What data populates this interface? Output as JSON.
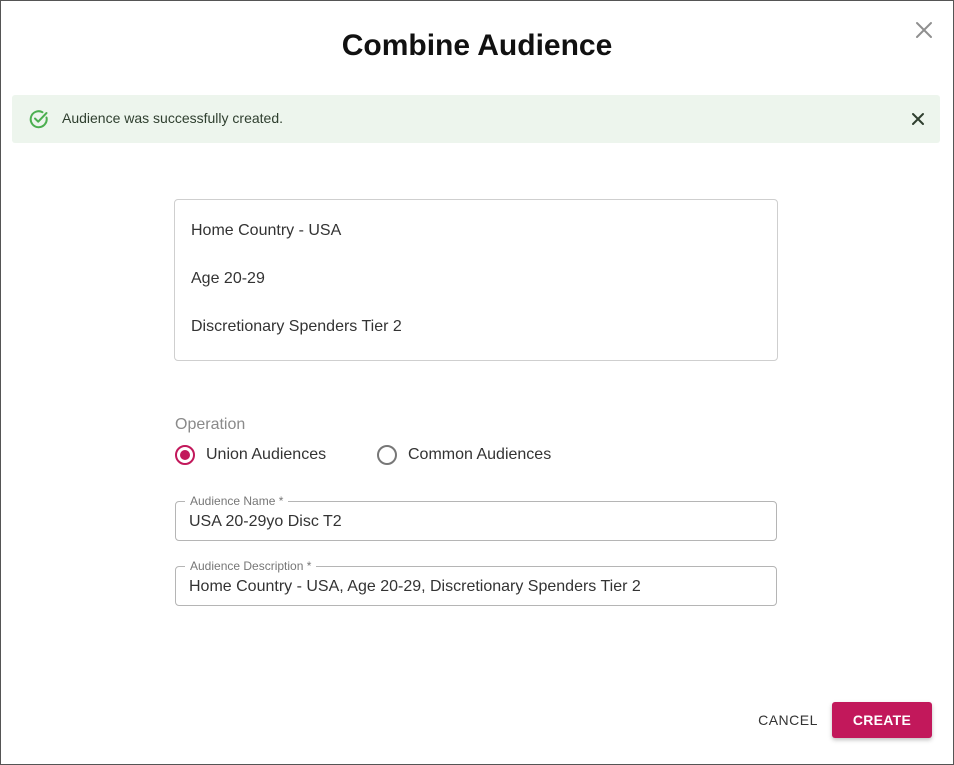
{
  "dialog": {
    "title": "Combine Audience",
    "close_icon": "close-icon"
  },
  "alert": {
    "message": "Audience was successfully created.",
    "icon": "check-circle-icon",
    "close_icon": "close-icon",
    "color": "#4caf50"
  },
  "selected_audiences": [
    "Home Country - USA",
    "Age 20-29",
    "Discretionary Spenders Tier 2"
  ],
  "operation": {
    "label": "Operation",
    "options": [
      {
        "label": "Union Audiences",
        "checked": true
      },
      {
        "label": "Common Audiences",
        "checked": false
      }
    ]
  },
  "form": {
    "name_label": "Audience Name *",
    "name_value": "USA 20-29yo Disc T2",
    "description_label": "Audience Description *",
    "description_value": "Home Country - USA, Age 20-29, Discretionary Spenders Tier 2"
  },
  "actions": {
    "cancel_label": "CANCEL",
    "create_label": "CREATE"
  },
  "colors": {
    "accent": "#c2185b",
    "success_bg": "#edf5ed"
  }
}
